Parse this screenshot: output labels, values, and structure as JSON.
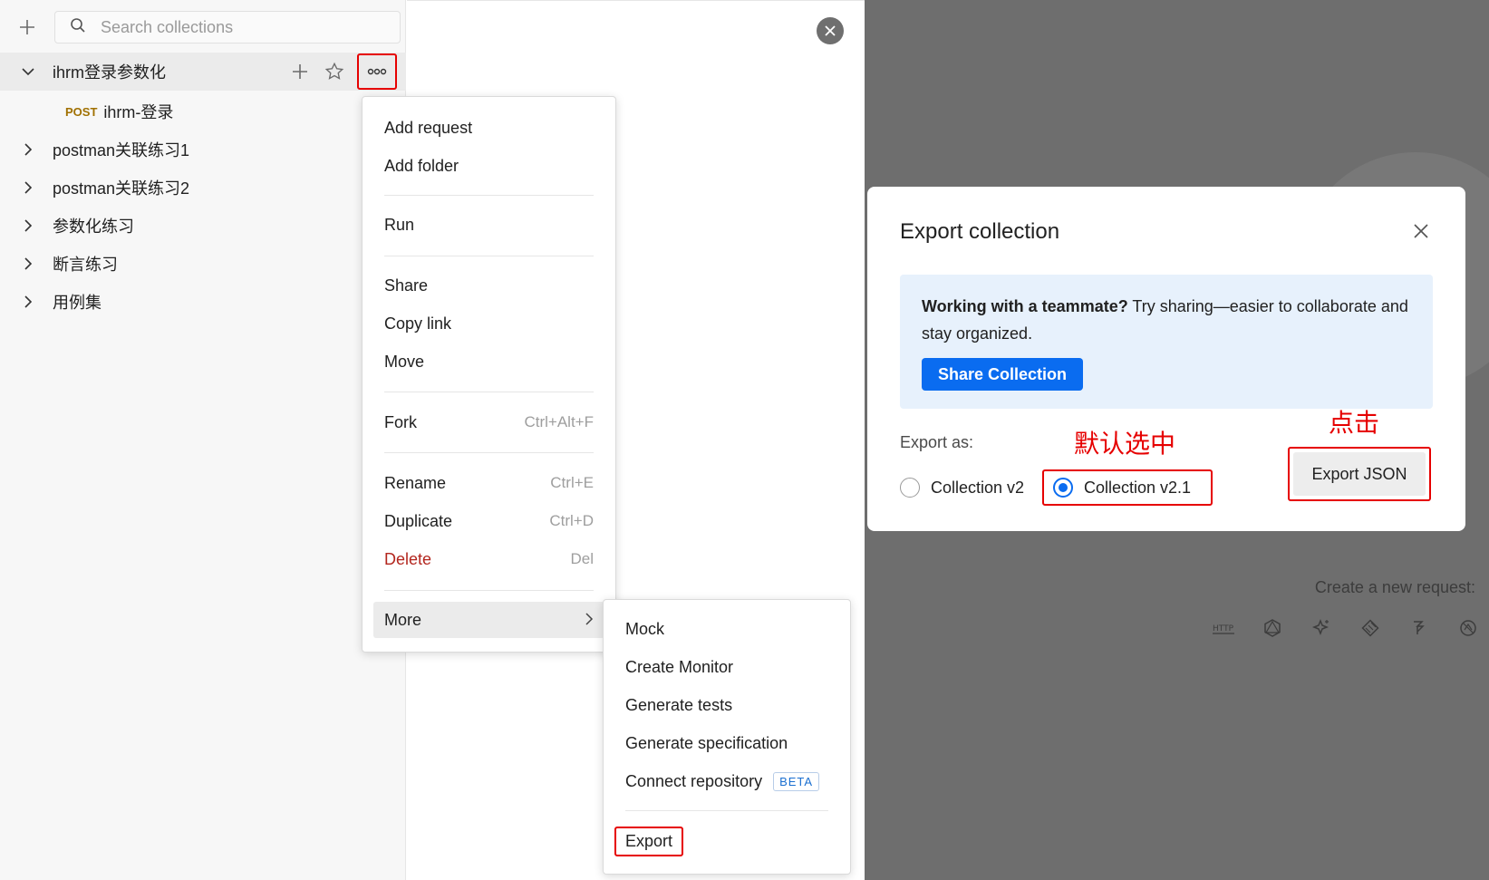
{
  "sidebar": {
    "search_placeholder": "Search collections",
    "collections": [
      {
        "name": "ihrm登录参数化",
        "expanded": true
      },
      {
        "name": "postman关联练习1"
      },
      {
        "name": "postman关联练习2"
      },
      {
        "name": "参数化练习"
      },
      {
        "name": "断言练习"
      },
      {
        "name": "用例集"
      }
    ],
    "request": {
      "method": "POST",
      "name": "ihrm-登录"
    }
  },
  "context_menu": {
    "items": [
      {
        "label": "Add request",
        "shortcut": ""
      },
      {
        "label": "Add folder",
        "shortcut": ""
      },
      {
        "label": "Run",
        "shortcut": ""
      },
      {
        "label": "Share",
        "shortcut": ""
      },
      {
        "label": "Copy link",
        "shortcut": ""
      },
      {
        "label": "Move",
        "shortcut": ""
      },
      {
        "label": "Fork",
        "shortcut": "Ctrl+Alt+F"
      },
      {
        "label": "Rename",
        "shortcut": "Ctrl+E"
      },
      {
        "label": "Duplicate",
        "shortcut": "Ctrl+D"
      },
      {
        "label": "Delete",
        "shortcut": "Del"
      },
      {
        "label": "More",
        "shortcut": ""
      }
    ]
  },
  "submenu": {
    "items": [
      "Mock",
      "Create Monitor",
      "Generate tests",
      "Generate specification",
      "Connect repository",
      "Export"
    ],
    "beta_badge": "BETA"
  },
  "modal": {
    "title": "Export collection",
    "banner_bold": "Working with a teammate?",
    "banner_text": " Try sharing—easier to collaborate and stay organized.",
    "share_button": "Share Collection",
    "export_as_label": "Export as:",
    "option_v2": "Collection v2",
    "option_v21": "Collection v2.1",
    "selected_option": "Collection v2.1",
    "export_button": "Export JSON"
  },
  "background": {
    "new_request_label": "Create a new request:",
    "icons": [
      "http-icon",
      "graphql-icon",
      "ai-icon",
      "grpc-icon",
      "websocket-icon",
      "socketio-icon"
    ]
  },
  "annotations": {
    "default_selected": "默认选中",
    "click": "点击"
  },
  "colors": {
    "accent": "#0a6cf0",
    "annotation_red": "#e60000",
    "post_method": "#a07000",
    "delete_red": "#b3261e"
  }
}
